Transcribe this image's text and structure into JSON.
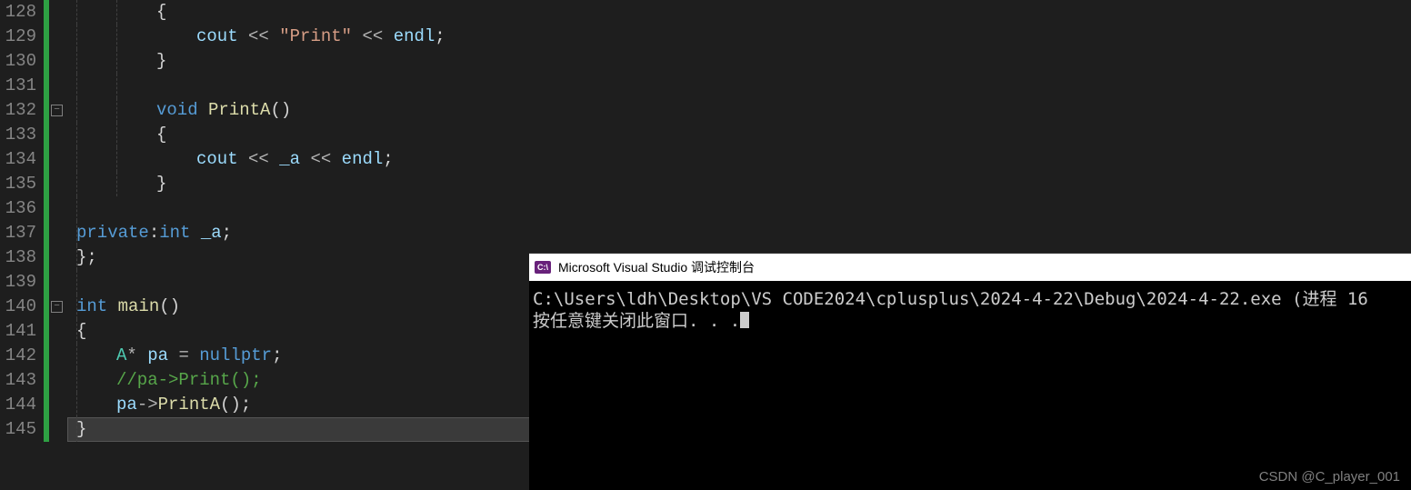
{
  "line_numbers": [
    "128",
    "129",
    "130",
    "131",
    "132",
    "133",
    "134",
    "135",
    "136",
    "137",
    "138",
    "139",
    "140",
    "141",
    "142",
    "143",
    "144",
    "145"
  ],
  "code": {
    "l128": {
      "i": 2,
      "t": [
        {
          "c": "pun",
          "v": "{"
        }
      ]
    },
    "l129": {
      "i": 3,
      "t": [
        {
          "c": "var",
          "v": "cout"
        },
        {
          "c": "txt",
          "v": " "
        },
        {
          "c": "op",
          "v": "<<"
        },
        {
          "c": "txt",
          "v": " "
        },
        {
          "c": "str",
          "v": "\"Print\""
        },
        {
          "c": "txt",
          "v": " "
        },
        {
          "c": "op",
          "v": "<<"
        },
        {
          "c": "txt",
          "v": " "
        },
        {
          "c": "var",
          "v": "endl"
        },
        {
          "c": "pun",
          "v": ";"
        }
      ]
    },
    "l130": {
      "i": 2,
      "t": [
        {
          "c": "pun",
          "v": "}"
        }
      ]
    },
    "l131": {
      "i": 0,
      "t": []
    },
    "l132": {
      "i": 2,
      "t": [
        {
          "c": "kw",
          "v": "void"
        },
        {
          "c": "txt",
          "v": " "
        },
        {
          "c": "fn",
          "v": "PrintA"
        },
        {
          "c": "pun",
          "v": "()"
        }
      ]
    },
    "l133": {
      "i": 2,
      "t": [
        {
          "c": "pun",
          "v": "{"
        }
      ]
    },
    "l134": {
      "i": 3,
      "t": [
        {
          "c": "var",
          "v": "cout"
        },
        {
          "c": "txt",
          "v": " "
        },
        {
          "c": "op",
          "v": "<<"
        },
        {
          "c": "txt",
          "v": " "
        },
        {
          "c": "var",
          "v": "_a"
        },
        {
          "c": "txt",
          "v": " "
        },
        {
          "c": "op",
          "v": "<<"
        },
        {
          "c": "txt",
          "v": " "
        },
        {
          "c": "var",
          "v": "endl"
        },
        {
          "c": "pun",
          "v": ";"
        }
      ]
    },
    "l135": {
      "i": 2,
      "t": [
        {
          "c": "pun",
          "v": "}"
        }
      ]
    },
    "l136": {
      "i": 0,
      "t": []
    },
    "l137": {
      "i": 0,
      "t": [
        {
          "c": "kw",
          "v": "private"
        },
        {
          "c": "pun",
          "v": ":"
        },
        {
          "c": "kw",
          "v": "int"
        },
        {
          "c": "txt",
          "v": " "
        },
        {
          "c": "var",
          "v": "_a"
        },
        {
          "c": "pun",
          "v": ";"
        }
      ]
    },
    "l138": {
      "i": 0,
      "t": [
        {
          "c": "pun",
          "v": "};"
        }
      ]
    },
    "l139": {
      "i": 0,
      "t": []
    },
    "l140": {
      "i": 0,
      "t": [
        {
          "c": "kw",
          "v": "int"
        },
        {
          "c": "txt",
          "v": " "
        },
        {
          "c": "fn",
          "v": "main"
        },
        {
          "c": "pun",
          "v": "()"
        }
      ]
    },
    "l141": {
      "i": 0,
      "t": [
        {
          "c": "pun",
          "v": "{"
        }
      ]
    },
    "l142": {
      "i": 1,
      "t": [
        {
          "c": "cls",
          "v": "A"
        },
        {
          "c": "op",
          "v": "*"
        },
        {
          "c": "txt",
          "v": " "
        },
        {
          "c": "var",
          "v": "pa"
        },
        {
          "c": "txt",
          "v": " "
        },
        {
          "c": "op",
          "v": "="
        },
        {
          "c": "txt",
          "v": " "
        },
        {
          "c": "kw",
          "v": "nullptr"
        },
        {
          "c": "pun",
          "v": ";"
        }
      ]
    },
    "l143": {
      "i": 1,
      "t": [
        {
          "c": "com",
          "v": "//pa->Print();"
        }
      ]
    },
    "l144": {
      "i": 1,
      "t": [
        {
          "c": "var",
          "v": "pa"
        },
        {
          "c": "op",
          "v": "->"
        },
        {
          "c": "fnm",
          "v": "PrintA"
        },
        {
          "c": "pun",
          "v": "();"
        }
      ]
    },
    "l145": {
      "i": 0,
      "t": [
        {
          "c": "pun",
          "v": "}"
        }
      ]
    }
  },
  "fold_markers": {
    "l132": "−",
    "l140": "−"
  },
  "console": {
    "icon_text": "C:\\",
    "title": "Microsoft Visual Studio 调试控制台",
    "line1": "C:\\Users\\ldh\\Desktop\\VS CODE2024\\cplusplus\\2024-4-22\\Debug\\2024-4-22.exe (进程 16",
    "line2": "按任意键关闭此窗口. . ."
  },
  "watermark": "CSDN @C_player_001",
  "colors": {
    "bg": "#1e1e1e",
    "change_bar": "#2ea043",
    "keyword": "#569cd6",
    "string": "#d69d85",
    "function": "#dcdcaa",
    "identifier": "#9cdcfe",
    "type": "#4ec9b0",
    "comment": "#57a64a"
  }
}
